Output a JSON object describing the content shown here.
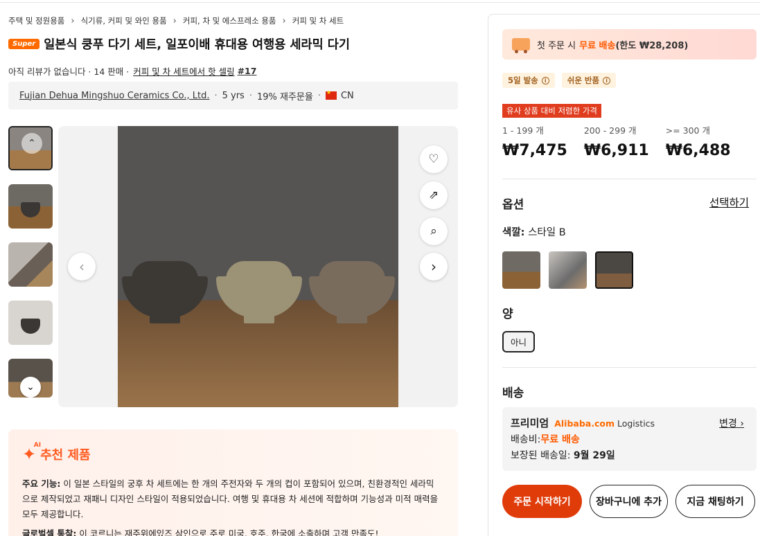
{
  "breadcrumb": [
    "주택 및 정원용품",
    "식기류, 커피 및 와인 용품",
    "커피, 차 및 에스프레소 용품",
    "커피 및 차 세트"
  ],
  "product": {
    "badge": "Super",
    "title": "일본식 쿵푸 다기 세트, 일포이배 휴대용 여행용 세라믹 다기",
    "reviews": "아직 리뷰가 없습니다 · 14 판매 ·",
    "bestseller_text": "커피 및 차 세트에서 핫 셀링",
    "bestseller_rank": "#17"
  },
  "supplier": {
    "name": "Fujian Dehua Mingshuo Ceramics Co., Ltd.",
    "years": "5 yrs",
    "reorder": "19% 재주문율",
    "country": "CN"
  },
  "gallery": {
    "thumb_icons": [
      "chevron-up-icon",
      "chevron-down-icon"
    ],
    "side_actions": [
      "heart-icon",
      "share-icon",
      "image-search-icon"
    ]
  },
  "ai": {
    "title": "추천 제품",
    "star_sup": "AI",
    "feature_label": "주요 기능:",
    "feature_text": "이 일본 스타일의 궁후 차 세트에는 한 개의 주전자와 두 개의 컵이 포함되어 있으며, 친환경적인 세라믹으로 제작되었고 재패니 디자인 스타일이 적용되었습니다. 여행 및 휴대용 차 세션에 적합하며 기능성과 미적 매력을 모두 제공합니다.",
    "extra_label": "글로벌셀 통찰:",
    "extra_text": "이 코르니는 재주위에있즈 삼인으로 주로 미국, 호주, 한국에 소출하며 고객 만족도!"
  },
  "panel": {
    "ship_banner": {
      "pre": "첫 주문 시",
      "free": "무료 배송",
      "cap": "(한도 ₩28,208)"
    },
    "tags": [
      "5일 발송",
      "쉬운 반품"
    ],
    "cheap_label": "유사 상품 대비 저렴한 가격",
    "tiers": [
      {
        "qty": "1 - 199 개",
        "price": "₩7,475"
      },
      {
        "qty": "200 - 299 개",
        "price": "₩6,911"
      },
      {
        "qty": ">= 300 개",
        "price": "₩6,488"
      }
    ],
    "options_title": "옵션",
    "options_select": "선택하기",
    "color_label": "색깔:",
    "color_value": "스타일 B",
    "amount_label": "양",
    "amount_value": "아니",
    "shipping_title": "배송",
    "shipping": {
      "tier": "프리미엄",
      "brand": "Alibaba.com",
      "brand_suffix": "Logistics",
      "change": "변경",
      "fee_label": "배송비:",
      "fee_value": "무료 배송",
      "eta_label": "보장된 배송일:",
      "eta_value": "9월 29일"
    },
    "buttons": {
      "order": "주문 시작하기",
      "cart": "장바구니에 추가",
      "chat": "지금 채팅하기"
    }
  },
  "colors": {
    "accent": "#ff6a00",
    "order_button": "#e03c0a",
    "cheap_badge": "#e03c1e"
  }
}
